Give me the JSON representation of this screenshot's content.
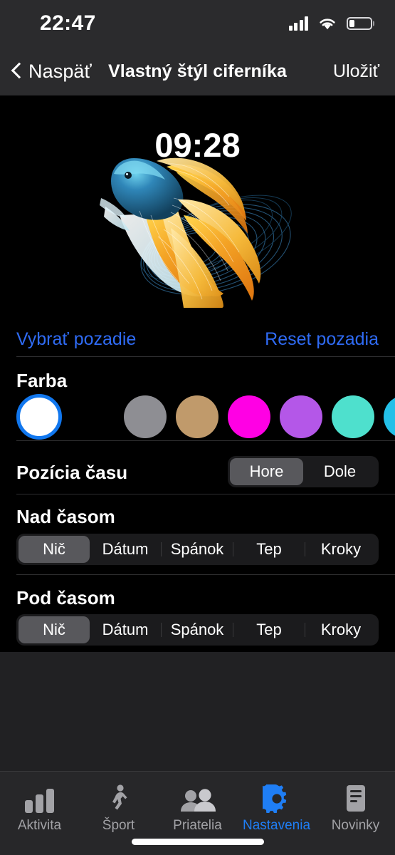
{
  "status_bar": {
    "time": "22:47",
    "icons": [
      "cellular-signal-icon",
      "wifi-icon",
      "battery-icon"
    ],
    "battery_level_pct": 24
  },
  "nav_bar": {
    "back_label": "Naspäť",
    "back_icon": "chevron-left-icon",
    "title": "Vlastný štýl ciferníka",
    "save_label": "Uložiť"
  },
  "preview": {
    "watch_time": "09:28",
    "wallpaper": "betta-fish-wallpaper"
  },
  "background_actions": {
    "choose_label": "Vybrať pozadie",
    "reset_label": "Reset pozadia",
    "link_color": "#2f6bf5"
  },
  "color_section": {
    "title": "Farba",
    "swatches": [
      {
        "name": "white",
        "hex": "#ffffff",
        "selected": true
      },
      {
        "name": "gray",
        "hex": "#8e8e93",
        "selected": false
      },
      {
        "name": "tan",
        "hex": "#c09a6b",
        "selected": false
      },
      {
        "name": "magenta",
        "hex": "#ff00e4",
        "selected": false
      },
      {
        "name": "purple",
        "hex": "#b457e8",
        "selected": false
      },
      {
        "name": "turquoise",
        "hex": "#4ee0cd",
        "selected": false
      },
      {
        "name": "cyan",
        "hex": "#24c0e8",
        "selected": false
      }
    ],
    "selection_ring_color": "#1177ee"
  },
  "time_position": {
    "label": "Pozícia času",
    "options": [
      {
        "label": "Hore",
        "selected": true
      },
      {
        "label": "Dole",
        "selected": false
      }
    ]
  },
  "above_time": {
    "label": "Nad časom",
    "options": [
      {
        "label": "Nič",
        "selected": true
      },
      {
        "label": "Dátum",
        "selected": false
      },
      {
        "label": "Spánok",
        "selected": false
      },
      {
        "label": "Tep",
        "selected": false
      },
      {
        "label": "Kroky",
        "selected": false
      }
    ]
  },
  "below_time": {
    "label": "Pod časom",
    "options": [
      {
        "label": "Nič",
        "selected": true
      },
      {
        "label": "Dátum",
        "selected": false
      },
      {
        "label": "Spánok",
        "selected": false
      },
      {
        "label": "Tep",
        "selected": false
      },
      {
        "label": "Kroky",
        "selected": false
      }
    ]
  },
  "tab_bar": {
    "active_color": "#1f7ef5",
    "inactive_color": "#a2a2a6",
    "tabs": [
      {
        "label": "Aktivita",
        "icon": "bar-chart-icon",
        "active": false
      },
      {
        "label": "Šport",
        "icon": "walking-person-icon",
        "active": false
      },
      {
        "label": "Priatelia",
        "icon": "two-people-icon",
        "active": false
      },
      {
        "label": "Nastavenia",
        "icon": "gear-icon",
        "active": true
      },
      {
        "label": "Novinky",
        "icon": "document-icon",
        "active": false
      }
    ]
  }
}
